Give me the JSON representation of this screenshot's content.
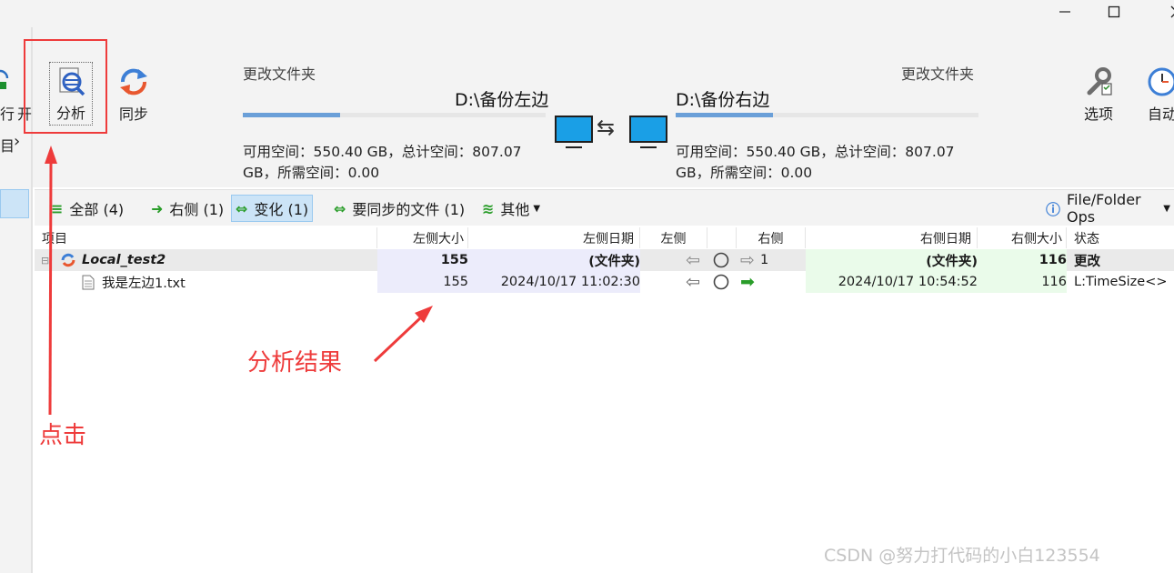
{
  "window": {
    "minimize_icon": "minimize-icon",
    "maximize_icon": "maximize-icon",
    "close_icon": "close-icon"
  },
  "left_panel": {
    "label_run": "行",
    "label_open": "开",
    "label_partial": "目",
    "chevron": "›"
  },
  "toolbar": {
    "analyze_label": "分析",
    "sync_label": "同步",
    "options_label": "选项",
    "auto_label": "自动"
  },
  "left_folder": {
    "caption": "更改文件夹",
    "path": "D:\\备份左边",
    "space_line1": "可用空间：550.40 GB，总计空间：807.07",
    "space_line2": "GB，所需空间：0.00",
    "progress_fraction": 0.32
  },
  "right_folder": {
    "caption": "更改文件夹",
    "path": "D:\\备份右边",
    "space_line1": "可用空间：550.40 GB，总计空间：807.07",
    "space_line2": "GB，所需空间：0.00",
    "progress_fraction": 0.32
  },
  "swap_glyph": "⇆",
  "filters": {
    "all": "全部 (4)",
    "right": "右侧 (1)",
    "changed": "变化 (1)",
    "to_sync": "要同步的文件 (1)",
    "other": "其他",
    "ops": "File/Folder Ops"
  },
  "columns": {
    "item": "项目",
    "left_size": "左侧大小",
    "left_date": "左侧日期",
    "left": "左侧",
    "right": "右侧",
    "right_date": "右侧日期",
    "right_size": "右侧大小",
    "status": "状态"
  },
  "rows": [
    {
      "name": "Local_test2",
      "left_size": "155",
      "left_date": "(文件夹)",
      "right_count": "1",
      "right_date": "(文件夹)",
      "right_size": "116",
      "status": "更改"
    },
    {
      "name": "我是左边1.txt",
      "left_size": "155",
      "left_date": "2024/10/17 11:02:30",
      "right_date": "2024/10/17 10:54:52",
      "right_size": "116",
      "status": "L:TimeSize<>"
    }
  ],
  "annotations": {
    "click": "点击",
    "result": "分析结果"
  },
  "watermark": "CSDN @努力打代码的小白123554",
  "colors": {
    "accent": "#6a9fd8",
    "annotation": "#ee3b3b",
    "left_tint": "#ececfb",
    "right_tint": "#eafbea"
  }
}
